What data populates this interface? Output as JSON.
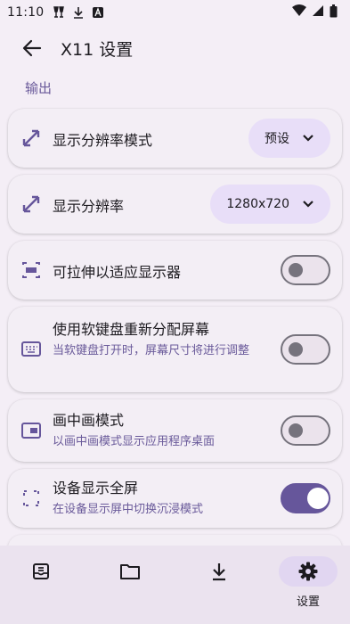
{
  "status_bar": {
    "time": "11:10",
    "icons": [
      "cheers-icon",
      "download-icon",
      "text-a-icon"
    ],
    "right_icons": [
      "wifi-icon",
      "signal-icon",
      "battery-icon"
    ]
  },
  "header": {
    "title": "X11 设置"
  },
  "section": {
    "label": "输出"
  },
  "settings": [
    {
      "title": "显示分辨率模式",
      "control": "dropdown",
      "value": "预设",
      "icon": "resize-arrows-icon"
    },
    {
      "title": "显示分辨率",
      "control": "dropdown",
      "value": "1280x720",
      "icon": "resize-arrows-icon"
    },
    {
      "title": "可拉伸以适应显示器",
      "control": "switch",
      "checked": false,
      "icon": "fit-screen-icon"
    },
    {
      "title": "使用软键盘重新分配屏幕",
      "subtitle": "当软键盘打开时，屏幕尺寸将进行调整",
      "control": "switch",
      "checked": false,
      "icon": "keyboard-icon"
    },
    {
      "title": "画中画模式",
      "subtitle": "以画中画模式显示应用程序桌面",
      "control": "switch",
      "checked": false,
      "icon": "picture-in-picture-icon"
    },
    {
      "title": "设备显示全屏",
      "subtitle": "在设备显示屏中切换沉浸模式",
      "control": "switch",
      "checked": true,
      "icon": "fullscreen-icon"
    }
  ],
  "bottom_nav": [
    {
      "icon": "archive-box-icon",
      "label": ""
    },
    {
      "icon": "folder-icon",
      "label": ""
    },
    {
      "icon": "download-icon",
      "label": ""
    },
    {
      "icon": "gear-icon",
      "label": "设置",
      "active": true
    }
  ],
  "colors": {
    "accent": "#66569b",
    "section_label": "#6a5a9a",
    "dropdown_bg": "#e8def8"
  }
}
